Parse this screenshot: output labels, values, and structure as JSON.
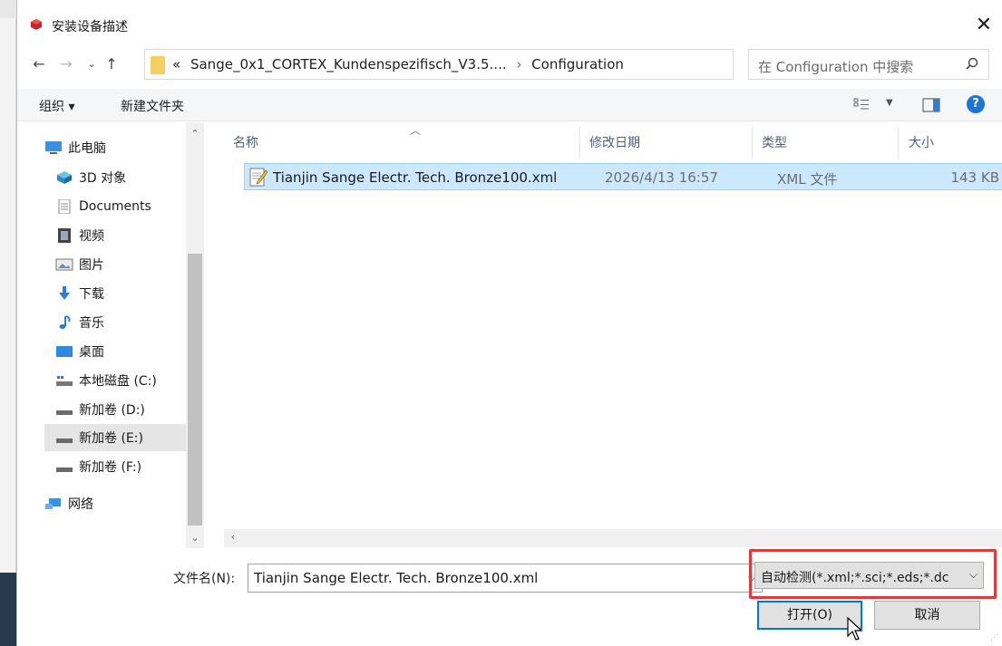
{
  "window": {
    "title": "安装设备描述",
    "close_glyph": "✕"
  },
  "address": {
    "prefix": "«",
    "folder": "Sange_0x1_CORTEX_Kundenspezifisch_V3.5....",
    "separator": "›",
    "current": "Configuration",
    "search_placeholder": "在 Configuration 中搜索"
  },
  "toolbar": {
    "organize_label": "组织 ▾",
    "new_folder_label": "新建文件夹"
  },
  "nav": {
    "items": [
      {
        "label": "此电脑",
        "icon": "computer-icon"
      },
      {
        "label": "3D 对象",
        "icon": "3d-objects-icon"
      },
      {
        "label": "Documents",
        "icon": "documents-icon"
      },
      {
        "label": "视频",
        "icon": "video-icon"
      },
      {
        "label": "图片",
        "icon": "pictures-icon"
      },
      {
        "label": "下载",
        "icon": "download-icon"
      },
      {
        "label": "音乐",
        "icon": "music-icon"
      },
      {
        "label": "桌面",
        "icon": "desktop-icon"
      },
      {
        "label": "本地磁盘 (C:)",
        "icon": "local-disk-icon"
      },
      {
        "label": "新加卷 (D:)",
        "icon": "drive-icon"
      },
      {
        "label": "新加卷 (E:)",
        "icon": "drive-icon"
      },
      {
        "label": "新加卷 (F:)",
        "icon": "drive-icon"
      },
      {
        "label": "网络",
        "icon": "network-icon"
      }
    ],
    "selected": "新加卷 (E:)"
  },
  "file_list": {
    "columns": [
      "名称",
      "修改日期",
      "类型",
      "大小"
    ],
    "rows": [
      {
        "name": "Tianjin Sange Electr. Tech. Bronze100.xml",
        "modified": "2026/4/13 16:57",
        "type": "XML 文件",
        "size": "143 KB"
      }
    ]
  },
  "footer": {
    "filename_label": "文件名(N):",
    "filename_value": "Tianjin Sange Electr. Tech. Bronze100.xml",
    "filetype_value": "自动检测(*.xml;*.sci;*.eds;*.dc",
    "open_label": "打开(O)",
    "cancel_label": "取消"
  },
  "colors": {
    "selection_bg": "#cce8ff",
    "selection_border": "#99d1ff",
    "highlight_border": "#e03b3b",
    "accent": "#0078d7"
  }
}
